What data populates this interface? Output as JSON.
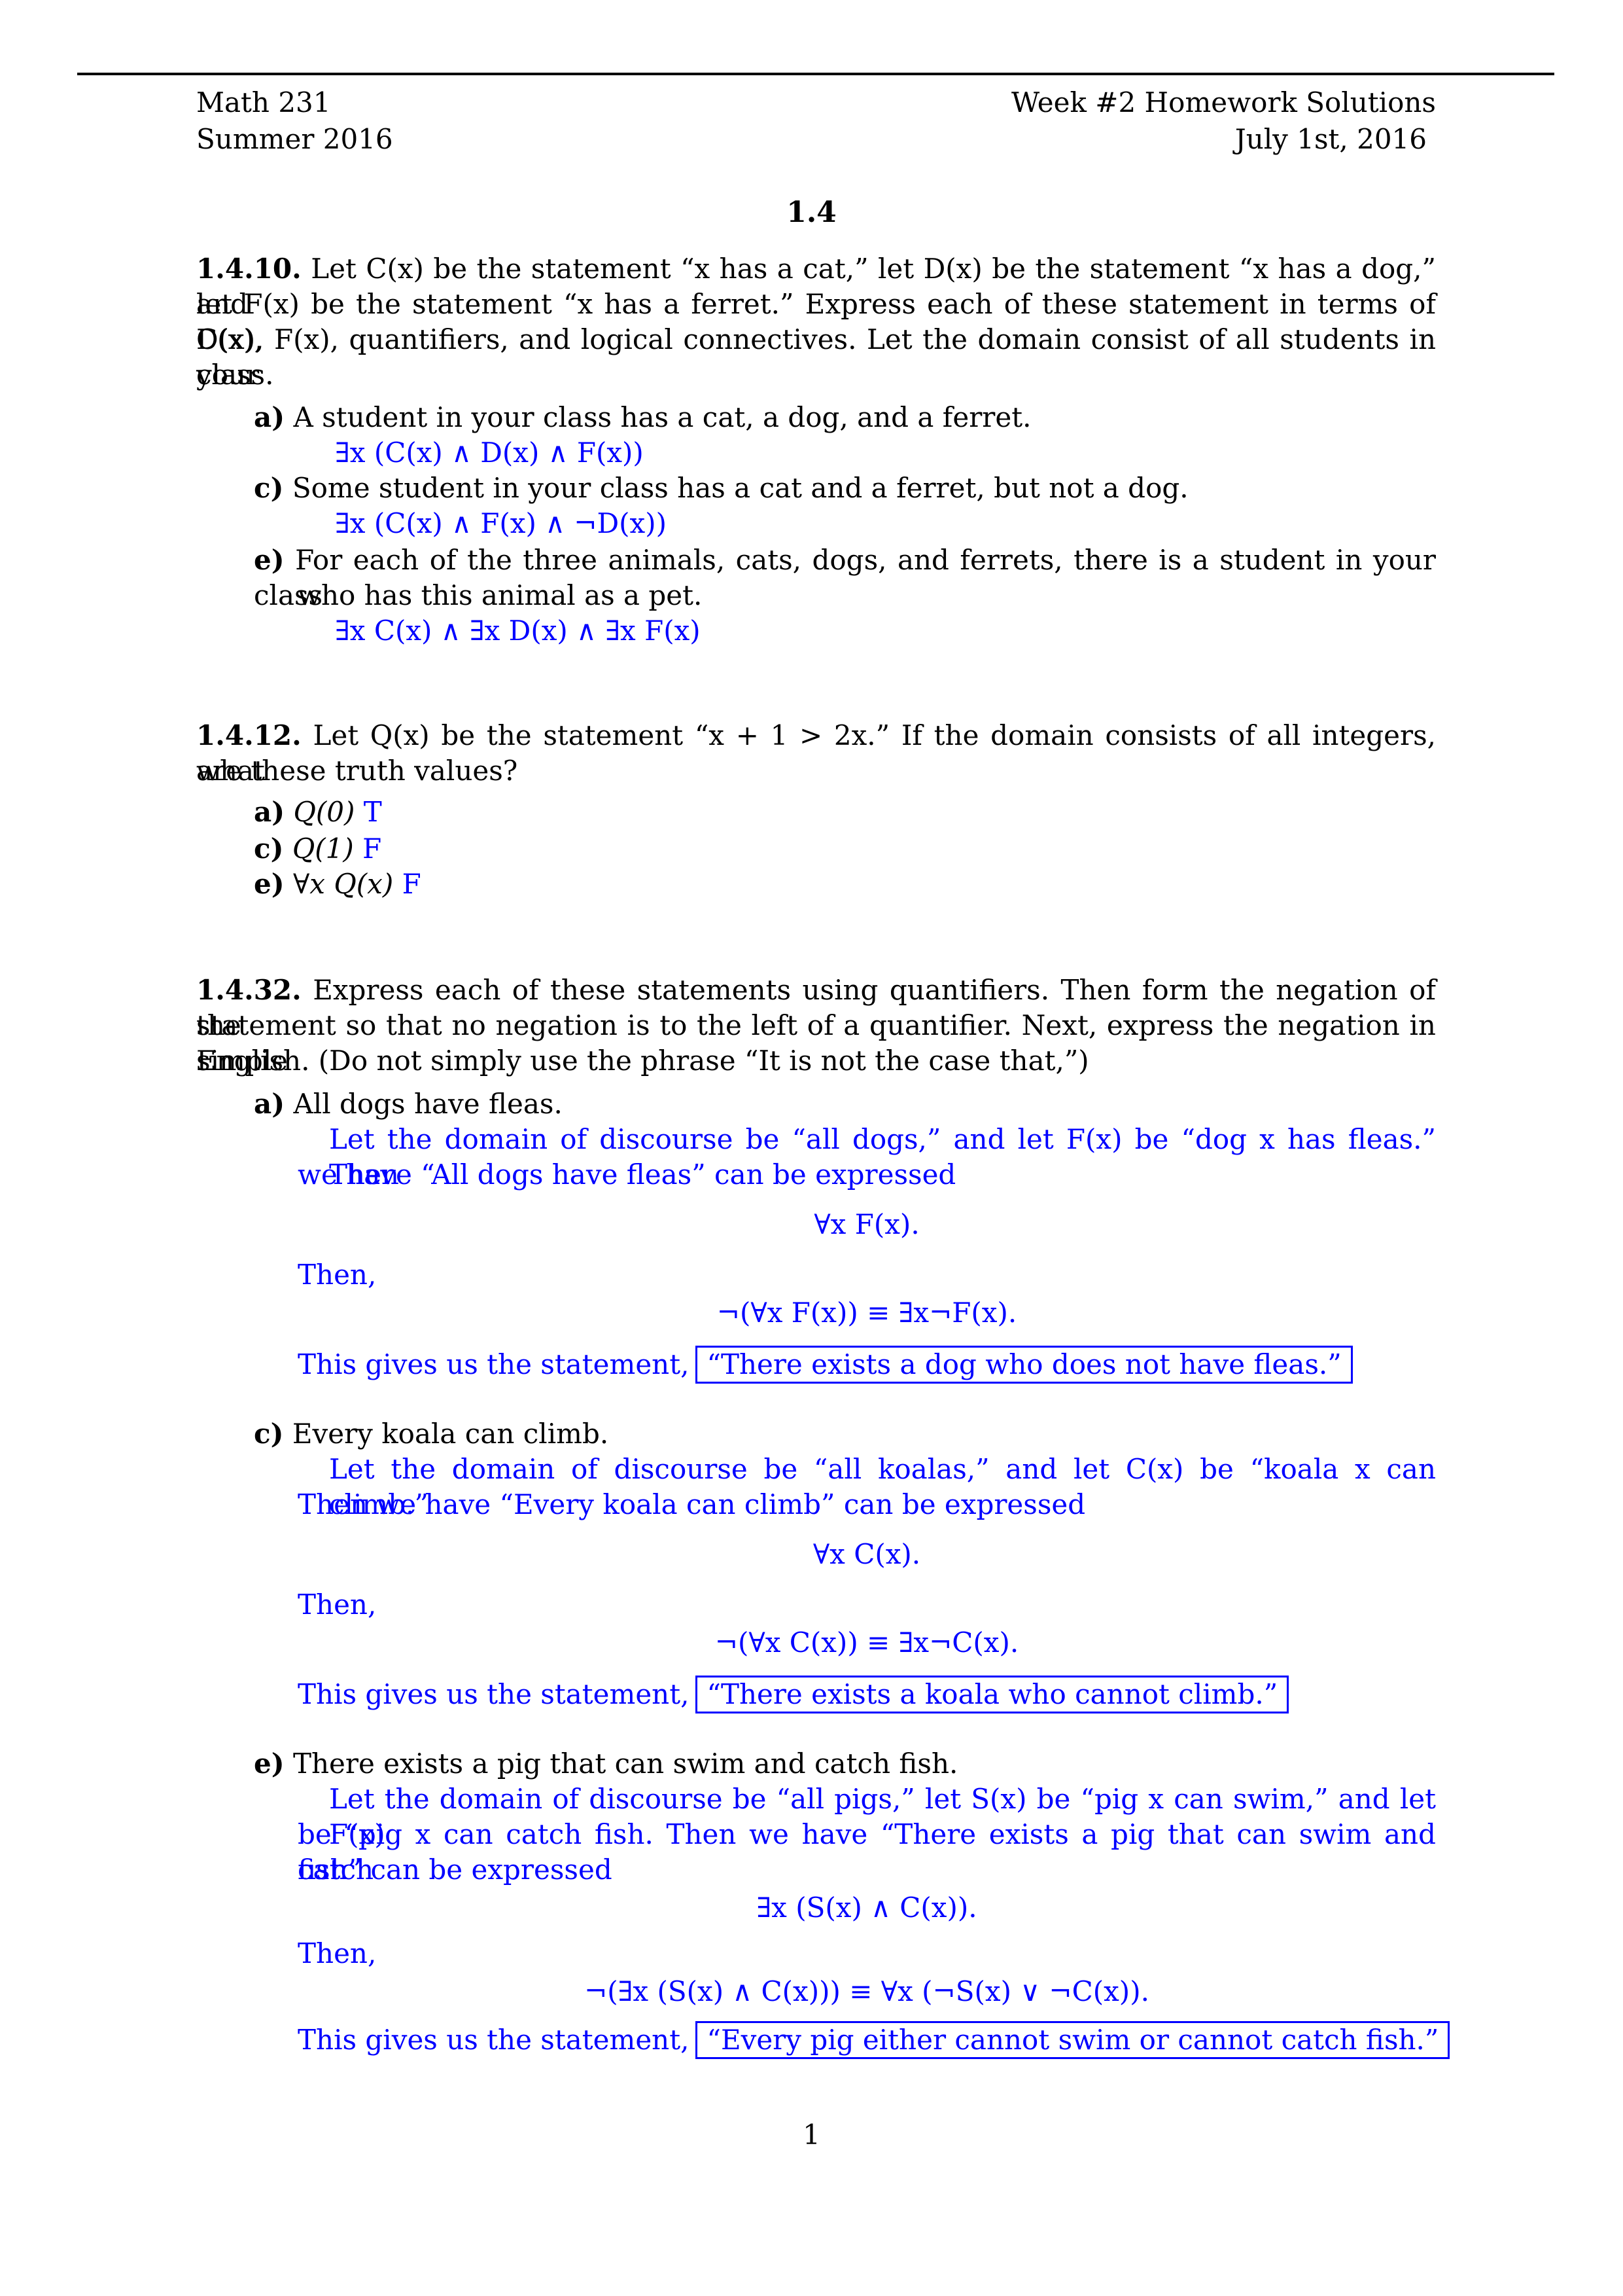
{
  "header": {
    "course": "Math 231",
    "term": "Summer 2016",
    "title": "Week #2 Homework Solutions",
    "date": "July 1st, 2016"
  },
  "section": "1.4",
  "problems": [
    {
      "number": "1.4.10.",
      "statement_lines": [
        "Let C(x) be the statement “x has a cat,” let D(x) be the statement “x has a dog,” and",
        "let F(x) be the statement “x has a ferret.” Express each of these statement in terms of C(x),",
        "D(x), F(x), quantifiers, and logical connectives. Let the domain consist of all students in your",
        "class."
      ],
      "parts": [
        {
          "label": "a)",
          "question": "A student in your class has a cat, a dog, and a ferret.",
          "answer": "∃x (C(x) ∧ D(x) ∧ F(x))"
        },
        {
          "label": "c)",
          "question": "Some student in your class has a cat and a ferret, but not a dog.",
          "answer": "∃x (C(x) ∧ F(x) ∧ ¬D(x))"
        },
        {
          "label": "e)",
          "question_lines": [
            "For each of the three animals, cats, dogs, and ferrets, there is a student in your class",
            "who has this animal as a pet."
          ],
          "answer": "∃x C(x) ∧ ∃x D(x) ∧ ∃x F(x)"
        }
      ]
    },
    {
      "number": "1.4.12.",
      "statement_lines": [
        "Let Q(x) be the statement “x + 1 > 2x.” If the domain consists of all integers, what",
        "are these truth values?"
      ],
      "parts": [
        {
          "label": "a)",
          "question": "Q(0)",
          "answer": "T"
        },
        {
          "label": "c)",
          "question": "Q(1)",
          "answer": "F"
        },
        {
          "label": "e)",
          "question": "∀x Q(x)",
          "answer": "F"
        }
      ]
    },
    {
      "number": "1.4.32.",
      "statement_lines": [
        "Express each of these statements using quantifiers. Then form the negation of the",
        "statement so that no negation is to the left of a quantifier. Next, express the negation in simple",
        "English. (Do not simply use the phrase “It is not the case that,”)"
      ],
      "parts": [
        {
          "label": "a)",
          "question": "All dogs have fleas.",
          "explanation_lines": [
            "Let the domain of discourse be “all dogs,” and let F(x) be “dog x has fleas.” Then",
            "we have “All dogs have fleas” can be expressed"
          ],
          "formula": "∀x F(x).",
          "then": "Then,",
          "negation": "¬(∀x F(x)) ≡ ∃x¬F(x).",
          "conclusion_prefix": "This gives us the statement,",
          "conclusion": "“There exists a dog who does not have fleas.”"
        },
        {
          "label": "c)",
          "question": "Every koala can climb.",
          "explanation_lines": [
            "Let the domain of discourse be “all koalas,” and let C(x) be “koala x can climb.”",
            "Then we have “Every koala can climb” can be expressed"
          ],
          "formula": "∀x C(x).",
          "then": "Then,",
          "negation": "¬(∀x C(x)) ≡ ∃x¬C(x).",
          "conclusion_prefix": "This gives us the statement,",
          "conclusion": "“There exists a koala who cannot climb.”"
        },
        {
          "label": "e)",
          "question": "There exists a pig that can swim and catch fish.",
          "explanation_lines": [
            "Let the domain of discourse be “all pigs,” let S(x) be “pig x can swim,” and let F(x)",
            "be “pig x can catch fish. Then we have “There exists a pig that can swim and catch",
            "fish” can be expressed"
          ],
          "formula": "∃x (S(x) ∧ C(x)).",
          "then": "Then,",
          "negation": "¬(∃x (S(x) ∧ C(x))) ≡ ∀x (¬S(x) ∨ ¬C(x)).",
          "conclusion_prefix": "This gives us the statement,",
          "conclusion": "“Every pig either cannot swim or cannot catch fish.”"
        }
      ]
    }
  ],
  "page_number": "1",
  "colors": {
    "answer": "#0000ff",
    "text": "#000000",
    "background": "#ffffff"
  }
}
